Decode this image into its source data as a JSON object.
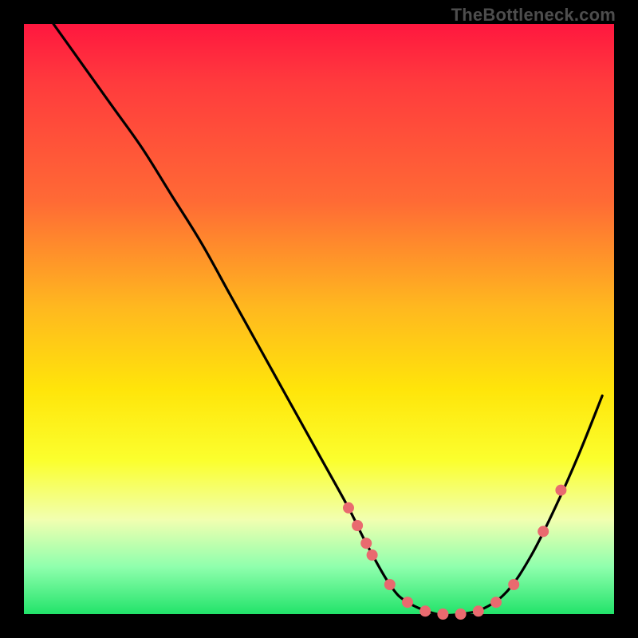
{
  "watermark": "TheBottleneck.com",
  "colors": {
    "background": "#000000",
    "gradient_top": "#ff173f",
    "gradient_bottom": "#22e36a",
    "curve": "#000000",
    "points": "#e96a6f"
  },
  "chart_data": {
    "type": "line",
    "title": "",
    "xlabel": "",
    "ylabel": "",
    "xlim": [
      0,
      100
    ],
    "ylim": [
      0,
      100
    ],
    "grid": false,
    "legend": false,
    "series": [
      {
        "name": "bottleneck-curve",
        "x": [
          5,
          10,
          15,
          20,
          25,
          30,
          35,
          40,
          45,
          50,
          55,
          58,
          62,
          65,
          70,
          74,
          78,
          82,
          86,
          90,
          94,
          98
        ],
        "y": [
          100,
          93,
          86,
          79,
          71,
          63,
          54,
          45,
          36,
          27,
          18,
          12,
          5,
          2,
          0,
          0,
          1,
          4,
          10,
          18,
          27,
          37
        ]
      }
    ],
    "highlight_points": {
      "name": "markers",
      "x": [
        55,
        56.5,
        58,
        59,
        62,
        65,
        68,
        71,
        74,
        77,
        80,
        83,
        88,
        91
      ],
      "y": [
        18,
        15,
        12,
        10,
        5,
        2,
        0.5,
        0,
        0,
        0.5,
        2,
        5,
        14,
        21
      ]
    }
  }
}
